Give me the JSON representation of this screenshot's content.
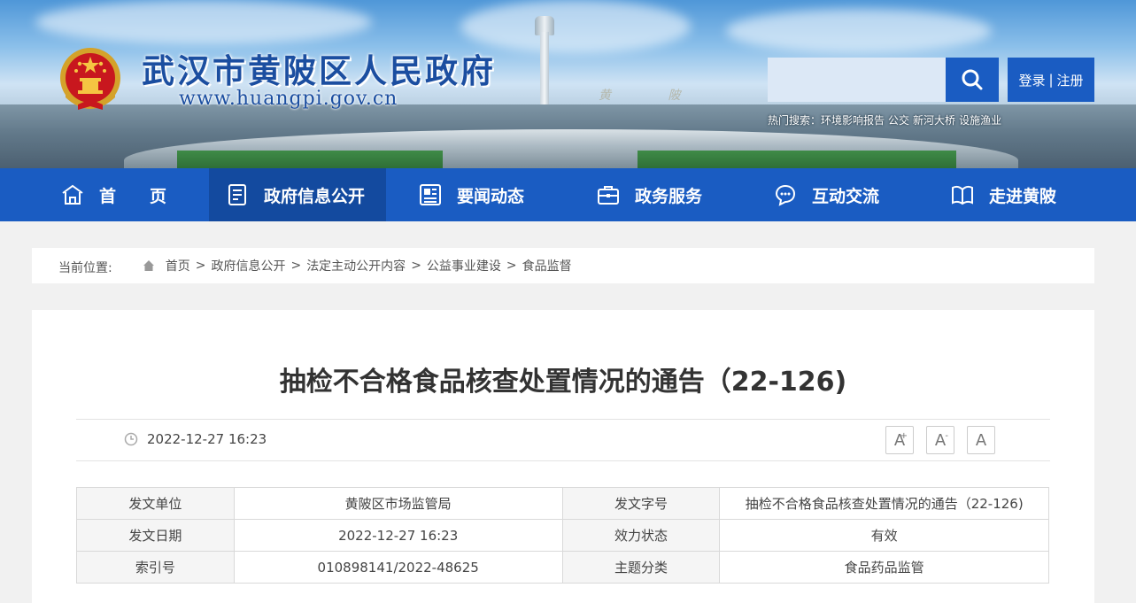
{
  "header": {
    "site_title": "武汉市黄陂区人民政府",
    "site_url": "www.huangpi.gov.cn",
    "search": {
      "placeholder": "",
      "value": ""
    },
    "login_label": "登录",
    "login_sep": "|",
    "register_label": "注册",
    "hot_search_label": "热门搜索：",
    "hot_keywords": [
      "环境影响报告",
      "公交",
      "新河大桥",
      "设施渔业"
    ],
    "watermark": "黄 陂"
  },
  "nav": {
    "items": [
      {
        "label": "首　　页",
        "icon": "home-icon"
      },
      {
        "label": "政府信息公开",
        "icon": "document-list-icon"
      },
      {
        "label": "要闻动态",
        "icon": "news-icon"
      },
      {
        "label": "政务服务",
        "icon": "briefcase-icon"
      },
      {
        "label": "互动交流",
        "icon": "chat-bubble-icon"
      },
      {
        "label": "走进黄陂",
        "icon": "book-icon"
      }
    ],
    "active_index": 1
  },
  "breadcrumb": {
    "label": "当前位置:",
    "items": [
      "首页",
      "政府信息公开",
      "法定主动公开内容",
      "公益事业建设",
      "食品监督"
    ],
    "separator": ">"
  },
  "article": {
    "title": "抽检不合格食品核查处置情况的通告（22-126)",
    "datetime": "2022-12-27 16:23",
    "font_controls": [
      "A",
      "A",
      "A"
    ],
    "font_control_marks": [
      "+",
      "-"
    ],
    "meta": [
      {
        "k1": "发文单位",
        "v1": "黄陂区市场监管局",
        "k2": "发文字号",
        "v2": "抽检不合格食品核查处置情况的通告（22-126)"
      },
      {
        "k1": "发文日期",
        "v1": "2022-12-27 16:23",
        "k2": "效力状态",
        "v2": "有效"
      },
      {
        "k1": "索引号",
        "v1": "010898141/2022-48625",
        "k2": "主题分类",
        "v2": "食品药品监管"
      }
    ]
  },
  "colors": {
    "primary": "#1a5cc2",
    "nav_active": "#134a9f",
    "page_bg": "#f1f1f1"
  }
}
